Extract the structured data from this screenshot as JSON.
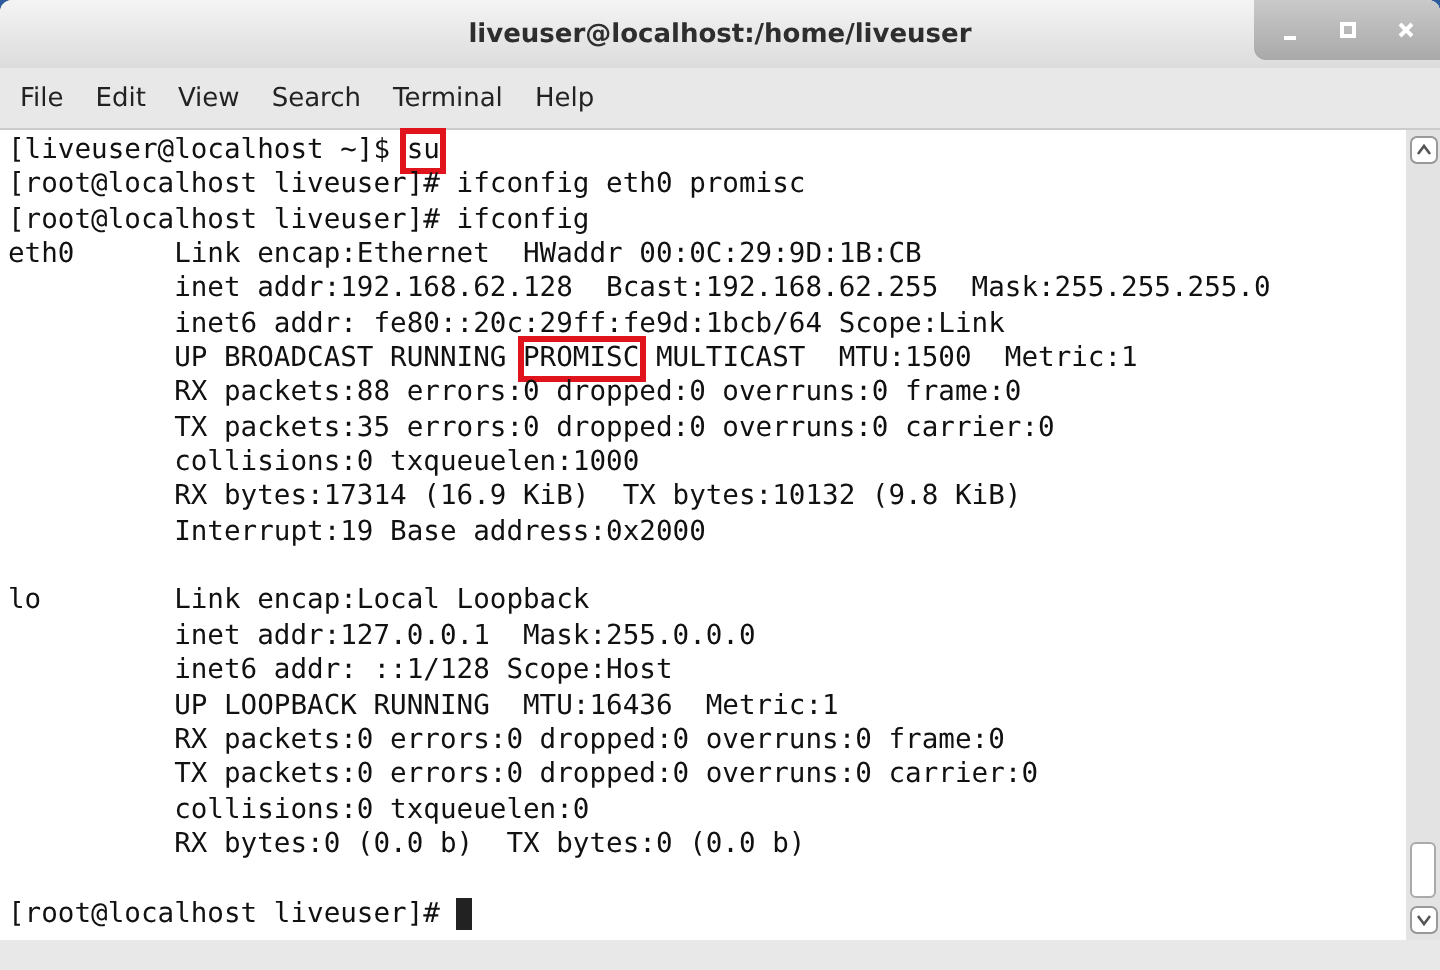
{
  "window": {
    "title": "liveuser@localhost:/home/liveuser"
  },
  "menu": [
    {
      "label": "File"
    },
    {
      "label": "Edit"
    },
    {
      "label": "View"
    },
    {
      "label": "Search"
    },
    {
      "label": "Terminal"
    },
    {
      "label": "Help"
    }
  ],
  "terminal": {
    "lines": [
      {
        "kind": "text",
        "segments": [
          {
            "text": "[liveuser@localhost ~]$ ",
            "highlighted": false
          },
          {
            "text": "su",
            "highlighted": true
          }
        ]
      },
      {
        "kind": "text",
        "segments": [
          {
            "text": "[root@localhost liveuser]# ifconfig eth0 promisc",
            "highlighted": false
          }
        ]
      },
      {
        "kind": "text",
        "segments": [
          {
            "text": "[root@localhost liveuser]# ifconfig",
            "highlighted": false
          }
        ]
      },
      {
        "kind": "text",
        "segments": [
          {
            "text": "eth0      Link encap:Ethernet  HWaddr 00:0C:29:9D:1B:CB",
            "highlighted": false
          }
        ]
      },
      {
        "kind": "text",
        "segments": [
          {
            "text": "          inet addr:192.168.62.128  Bcast:192.168.62.255  Mask:255.255.255.0",
            "highlighted": false
          }
        ]
      },
      {
        "kind": "text",
        "segments": [
          {
            "text": "          inet6 addr: fe80::20c:29ff:fe9d:1bcb/64 Scope:Link",
            "highlighted": false
          }
        ]
      },
      {
        "kind": "text",
        "segments": [
          {
            "text": "          UP BROADCAST RUNNING ",
            "highlighted": false
          },
          {
            "text": "PROMISC",
            "highlighted": true
          },
          {
            "text": " MULTICAST  MTU:1500  Metric:1",
            "highlighted": false
          }
        ]
      },
      {
        "kind": "text",
        "segments": [
          {
            "text": "          RX packets:88 errors:0 dropped:0 overruns:0 frame:0",
            "highlighted": false
          }
        ]
      },
      {
        "kind": "text",
        "segments": [
          {
            "text": "          TX packets:35 errors:0 dropped:0 overruns:0 carrier:0",
            "highlighted": false
          }
        ]
      },
      {
        "kind": "text",
        "segments": [
          {
            "text": "          collisions:0 txqueuelen:1000",
            "highlighted": false
          }
        ]
      },
      {
        "kind": "text",
        "segments": [
          {
            "text": "          RX bytes:17314 (16.9 KiB)  TX bytes:10132 (9.8 KiB)",
            "highlighted": false
          }
        ]
      },
      {
        "kind": "text",
        "segments": [
          {
            "text": "          Interrupt:19 Base address:0x2000",
            "highlighted": false
          }
        ]
      },
      {
        "kind": "blank"
      },
      {
        "kind": "text",
        "segments": [
          {
            "text": "lo        Link encap:Local Loopback",
            "highlighted": false
          }
        ]
      },
      {
        "kind": "text",
        "segments": [
          {
            "text": "          inet addr:127.0.0.1  Mask:255.0.0.0",
            "highlighted": false
          }
        ]
      },
      {
        "kind": "text",
        "segments": [
          {
            "text": "          inet6 addr: ::1/128 Scope:Host",
            "highlighted": false
          }
        ]
      },
      {
        "kind": "text",
        "segments": [
          {
            "text": "          UP LOOPBACK RUNNING  MTU:16436  Metric:1",
            "highlighted": false
          }
        ]
      },
      {
        "kind": "text",
        "segments": [
          {
            "text": "          RX packets:0 errors:0 dropped:0 overruns:0 frame:0",
            "highlighted": false
          }
        ]
      },
      {
        "kind": "text",
        "segments": [
          {
            "text": "          TX packets:0 errors:0 dropped:0 overruns:0 carrier:0",
            "highlighted": false
          }
        ]
      },
      {
        "kind": "text",
        "segments": [
          {
            "text": "          collisions:0 txqueuelen:0",
            "highlighted": false
          }
        ]
      },
      {
        "kind": "text",
        "segments": [
          {
            "text": "          RX bytes:0 (0.0 b)  TX bytes:0 (0.0 b)",
            "highlighted": false
          }
        ]
      },
      {
        "kind": "blank"
      },
      {
        "kind": "prompt",
        "segments": [
          {
            "text": "[root@localhost liveuser]# ",
            "highlighted": false
          }
        ]
      }
    ]
  }
}
